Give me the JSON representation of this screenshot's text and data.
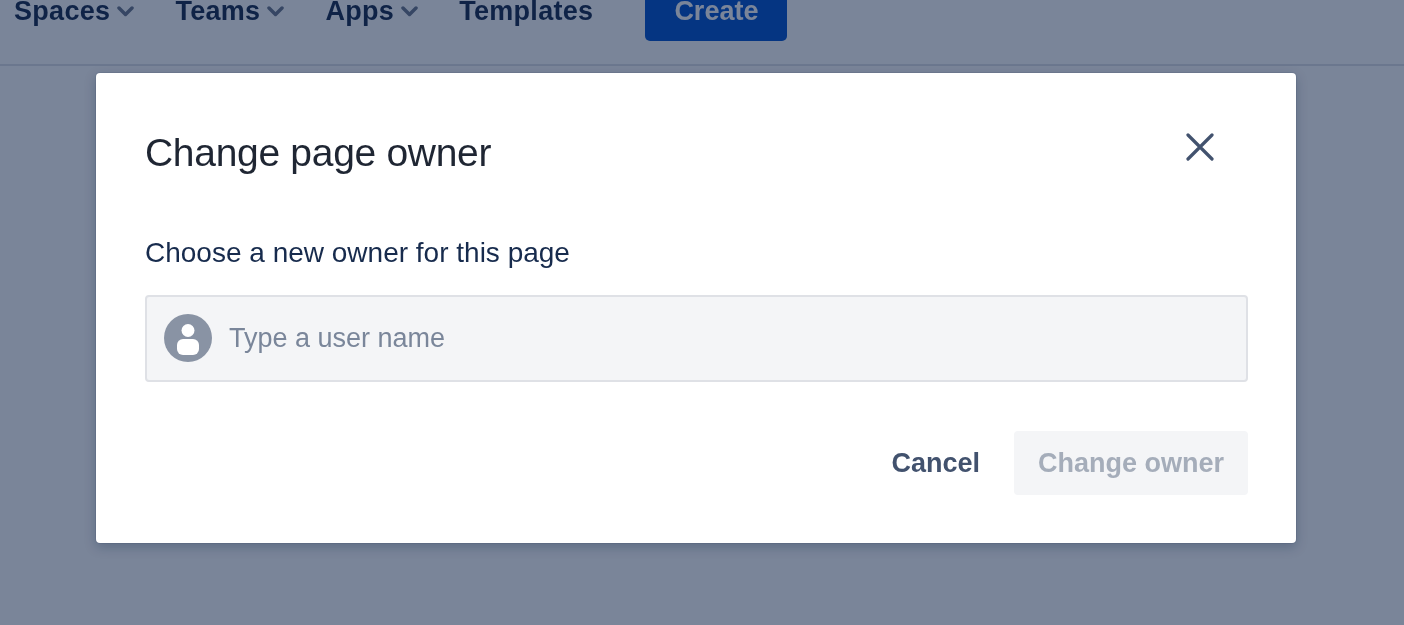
{
  "nav": {
    "items": [
      {
        "label": "Spaces",
        "dropdown": true
      },
      {
        "label": "Teams",
        "dropdown": true
      },
      {
        "label": "Apps",
        "dropdown": true
      },
      {
        "label": "Templates",
        "dropdown": false
      }
    ],
    "create_button": "Create"
  },
  "dialog": {
    "title": "Change page owner",
    "field_label": "Choose a new owner for this page",
    "user_field": {
      "placeholder": "Type a user name"
    },
    "buttons": [
      {
        "label": "Cancel",
        "kind": "subtle",
        "disabled": false
      },
      {
        "label": "Change owner",
        "kind": "primary",
        "disabled": true
      }
    ]
  }
}
